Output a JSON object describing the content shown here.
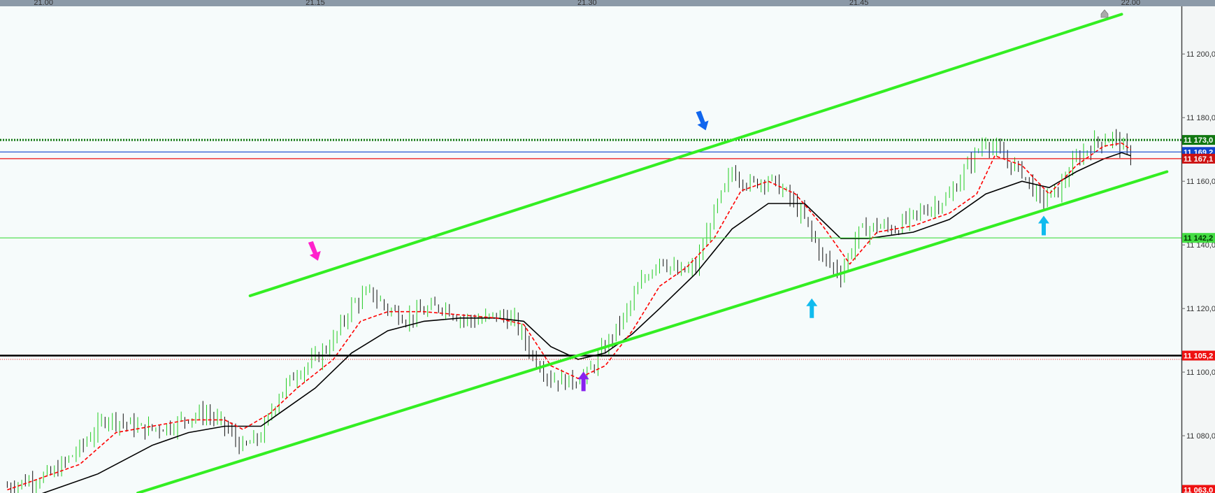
{
  "chart_data": {
    "type": "candlestick",
    "x_ticks": [
      "21.00",
      "21.15",
      "21.30",
      "21.45",
      "22.00"
    ],
    "x_ticks_minutes": [
      0,
      15,
      30,
      45,
      60
    ],
    "x_range_minutes": [
      -2.4,
      62.8
    ],
    "y_ticks": [
      "11 200,0",
      "11 180,0",
      "11 160,0",
      "11 140,0",
      "11 120,0",
      "11 100,0",
      "11 080,0"
    ],
    "y_ticks_values": [
      11200,
      11180,
      11160,
      11140,
      11120,
      11100,
      11080
    ],
    "y_range": [
      11062,
      11215
    ],
    "grid": false,
    "colors": {
      "background": "#ffffff",
      "chart_tint": "#f6fbfb",
      "axis_band": "#8c9aa8",
      "bull": "#22cc22",
      "bear": "#111111",
      "fast_ma": "#ff0000",
      "slow_ma": "#000000",
      "channel": "#33ee22",
      "level_green_dotted": "#117711",
      "level_blue": "#1144cc",
      "level_red": "#ee1111",
      "level_lime": "#44dd44",
      "level_black": "#000000"
    },
    "levels": [
      {
        "value": 11173.0,
        "label": "11 173,0",
        "color": "#117711",
        "tag_bg": "#117711",
        "tag_fg": "#ffffff",
        "style": "dotted-thick"
      },
      {
        "value": 11169.2,
        "label": "11 169,2",
        "color": "#1144cc",
        "tag_bg": "#1144cc",
        "tag_fg": "#ffffff",
        "style": "solid"
      },
      {
        "value": 11167.1,
        "label": "11 167,1",
        "color": "#ee1111",
        "tag_bg": "#cc1111",
        "tag_fg": "#ffffff",
        "style": "solid"
      },
      {
        "value": 11142.2,
        "label": "11 142,2",
        "color": "#44dd44",
        "tag_bg": "#44dd44",
        "tag_fg": "#003300",
        "style": "solid"
      },
      {
        "value": 11105.2,
        "label": "11 105,2",
        "color": "#000000",
        "tag_bg": "#ee1111",
        "tag_fg": "#ffffff",
        "style": "solid-thick"
      },
      {
        "value": 11104.0,
        "label": "",
        "color": "#ee1111",
        "tag_bg": "",
        "tag_fg": "",
        "style": "dotted"
      },
      {
        "value": 11063.0,
        "label": "11 063,0",
        "color": "#ee1111",
        "tag_bg": "#ee1111",
        "tag_fg": "#ffffff",
        "style": "tag-only"
      }
    ],
    "channels": [
      {
        "name": "upper",
        "from": [
          11.4,
          11124
        ],
        "to": [
          59.5,
          11212.5
        ]
      },
      {
        "name": "lower",
        "from": [
          5.2,
          11062
        ],
        "to": [
          62.0,
          11163
        ]
      }
    ],
    "arrows": [
      {
        "color": "#ff22cc",
        "direction": "down",
        "at": [
          14.8,
          11135
        ]
      },
      {
        "color": "#1166ee",
        "direction": "down",
        "at": [
          36.2,
          11176
        ]
      },
      {
        "color": "#8822ee",
        "direction": "up",
        "at": [
          29.8,
          11094
        ]
      },
      {
        "color": "#11bbee",
        "direction": "up",
        "at": [
          42.4,
          11117
        ]
      },
      {
        "color": "#11bbee",
        "direction": "up",
        "at": [
          55.2,
          11143
        ]
      }
    ],
    "price_path": [
      [
        -2.0,
        11064
      ],
      [
        0.5,
        11068
      ],
      [
        2.0,
        11076
      ],
      [
        3.5,
        11086
      ],
      [
        4.5,
        11084
      ],
      [
        5.5,
        11082
      ],
      [
        7.0,
        11083
      ],
      [
        8.0,
        11086
      ],
      [
        9.0,
        11087
      ],
      [
        10.0,
        11083
      ],
      [
        11.0,
        11076
      ],
      [
        12.0,
        11080
      ],
      [
        13.0,
        11093
      ],
      [
        14.0,
        11100
      ],
      [
        15.0,
        11104
      ],
      [
        16.0,
        11110
      ],
      [
        17.0,
        11121
      ],
      [
        18.0,
        11125
      ],
      [
        19.0,
        11120
      ],
      [
        20.0,
        11117
      ],
      [
        21.0,
        11119
      ],
      [
        22.0,
        11121
      ],
      [
        23.0,
        11117
      ],
      [
        24.0,
        11116
      ],
      [
        25.0,
        11118
      ],
      [
        26.0,
        11116
      ],
      [
        27.0,
        11105
      ],
      [
        28.0,
        11098
      ],
      [
        29.0,
        11097
      ],
      [
        30.0,
        11099
      ],
      [
        31.0,
        11108
      ],
      [
        32.0,
        11117
      ],
      [
        33.0,
        11128
      ],
      [
        34.0,
        11136
      ],
      [
        35.0,
        11131
      ],
      [
        36.0,
        11133
      ],
      [
        37.0,
        11150
      ],
      [
        38.0,
        11163
      ],
      [
        39.0,
        11159
      ],
      [
        40.0,
        11161
      ],
      [
        41.0,
        11156
      ],
      [
        42.0,
        11148
      ],
      [
        43.0,
        11136
      ],
      [
        44.0,
        11131
      ],
      [
        45.0,
        11144
      ],
      [
        46.0,
        11146
      ],
      [
        47.0,
        11145
      ],
      [
        48.0,
        11149
      ],
      [
        49.0,
        11152
      ],
      [
        50.0,
        11155
      ],
      [
        51.0,
        11165
      ],
      [
        52.0,
        11173
      ],
      [
        53.0,
        11167
      ],
      [
        54.0,
        11163
      ],
      [
        55.0,
        11154
      ],
      [
        56.0,
        11157
      ],
      [
        57.0,
        11167
      ],
      [
        58.0,
        11172
      ],
      [
        59.0,
        11174
      ],
      [
        60.0,
        11168
      ]
    ],
    "fast_ma": [
      [
        -2.0,
        11063
      ],
      [
        2.0,
        11071
      ],
      [
        4.0,
        11081
      ],
      [
        6.0,
        11083
      ],
      [
        8.0,
        11085
      ],
      [
        10.0,
        11085
      ],
      [
        11.0,
        11082
      ],
      [
        12.5,
        11087
      ],
      [
        14.0,
        11095
      ],
      [
        16.0,
        11104
      ],
      [
        17.5,
        11116
      ],
      [
        19.0,
        11119
      ],
      [
        21.0,
        11119
      ],
      [
        23.0,
        11118
      ],
      [
        25.0,
        11117
      ],
      [
        26.5,
        11115
      ],
      [
        28.0,
        11102
      ],
      [
        29.5,
        11098
      ],
      [
        31.0,
        11102
      ],
      [
        32.5,
        11113
      ],
      [
        34.0,
        11127
      ],
      [
        35.5,
        11133
      ],
      [
        37.0,
        11142
      ],
      [
        38.5,
        11157
      ],
      [
        40.0,
        11160
      ],
      [
        41.5,
        11156
      ],
      [
        43.0,
        11146
      ],
      [
        44.5,
        11134
      ],
      [
        46.0,
        11144
      ],
      [
        48.0,
        11146
      ],
      [
        50.0,
        11150
      ],
      [
        51.5,
        11156
      ],
      [
        52.5,
        11168
      ],
      [
        54.0,
        11165
      ],
      [
        55.5,
        11156
      ],
      [
        57.0,
        11165
      ],
      [
        58.5,
        11171
      ],
      [
        59.5,
        11172
      ],
      [
        60.0,
        11170
      ]
    ],
    "slow_ma": [
      [
        -2.0,
        11058
      ],
      [
        3.0,
        11068
      ],
      [
        6.0,
        11077
      ],
      [
        8.0,
        11081
      ],
      [
        10.0,
        11083
      ],
      [
        12.0,
        11083
      ],
      [
        13.0,
        11087
      ],
      [
        15.0,
        11095
      ],
      [
        17.0,
        11106
      ],
      [
        19.0,
        11113
      ],
      [
        21.0,
        11116
      ],
      [
        23.0,
        11117
      ],
      [
        25.0,
        11117
      ],
      [
        26.5,
        11116
      ],
      [
        28.0,
        11108
      ],
      [
        29.5,
        11104
      ],
      [
        31.0,
        11106
      ],
      [
        32.5,
        11112
      ],
      [
        34.0,
        11120
      ],
      [
        36.0,
        11131
      ],
      [
        38.0,
        11145
      ],
      [
        40.0,
        11153
      ],
      [
        42.0,
        11153
      ],
      [
        44.0,
        11142
      ],
      [
        45.5,
        11142
      ],
      [
        48.0,
        11144
      ],
      [
        50.0,
        11148
      ],
      [
        52.0,
        11156
      ],
      [
        54.0,
        11160
      ],
      [
        55.5,
        11158
      ],
      [
        57.0,
        11163
      ],
      [
        58.5,
        11167
      ],
      [
        59.5,
        11169
      ],
      [
        60.0,
        11168
      ]
    ]
  }
}
